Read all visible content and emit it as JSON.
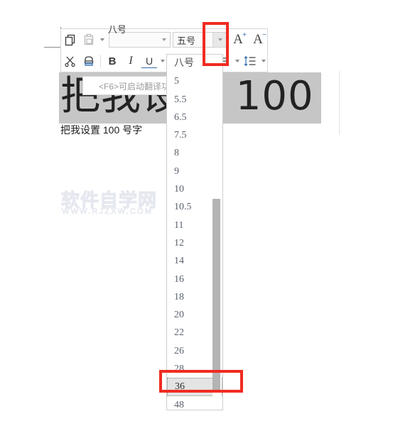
{
  "toolbar": {
    "copy_icon": "copy-icon",
    "paste_icon": "paste-icon",
    "paste_caret": "chevron-down-icon",
    "cut_icon": "scissors-icon",
    "format_painter_icon": "format-painter-icon",
    "font_name_value": "",
    "font_name_placeholder": "",
    "font_size_value": "五号",
    "font_size_peek": "八号",
    "bold_label": "B",
    "italic_label": "I",
    "underline_label": "U",
    "increase_font_label": "A",
    "increase_font_sup": "+",
    "decrease_font_label": "A",
    "decrease_font_sup": "−",
    "bullet_list_icon": "bullet-list-icon",
    "line_spacing_icon": "line-spacing-icon"
  },
  "document": {
    "selected_text": "把我设置 100 号字",
    "normal_text": "把我设置 100 号字",
    "tooltip_text": "<F6>可启动翻译功"
  },
  "watermark": {
    "cn": "软件自学网",
    "en": "WWW.RJZXW.COM"
  },
  "size_dropdown": {
    "selected_value": "36",
    "items": [
      "八号",
      "5",
      "5.5",
      "6.5",
      "7.5",
      "8",
      "9",
      "10",
      "10.5",
      "11",
      "12",
      "14",
      "16",
      "18",
      "20",
      "22",
      "26",
      "28",
      "36",
      "48"
    ]
  },
  "annotations": {
    "dropdown_arrow_box": "red-highlight-rectangle",
    "size36_box": "red-highlight-rectangle",
    "color": "#f02b21"
  }
}
